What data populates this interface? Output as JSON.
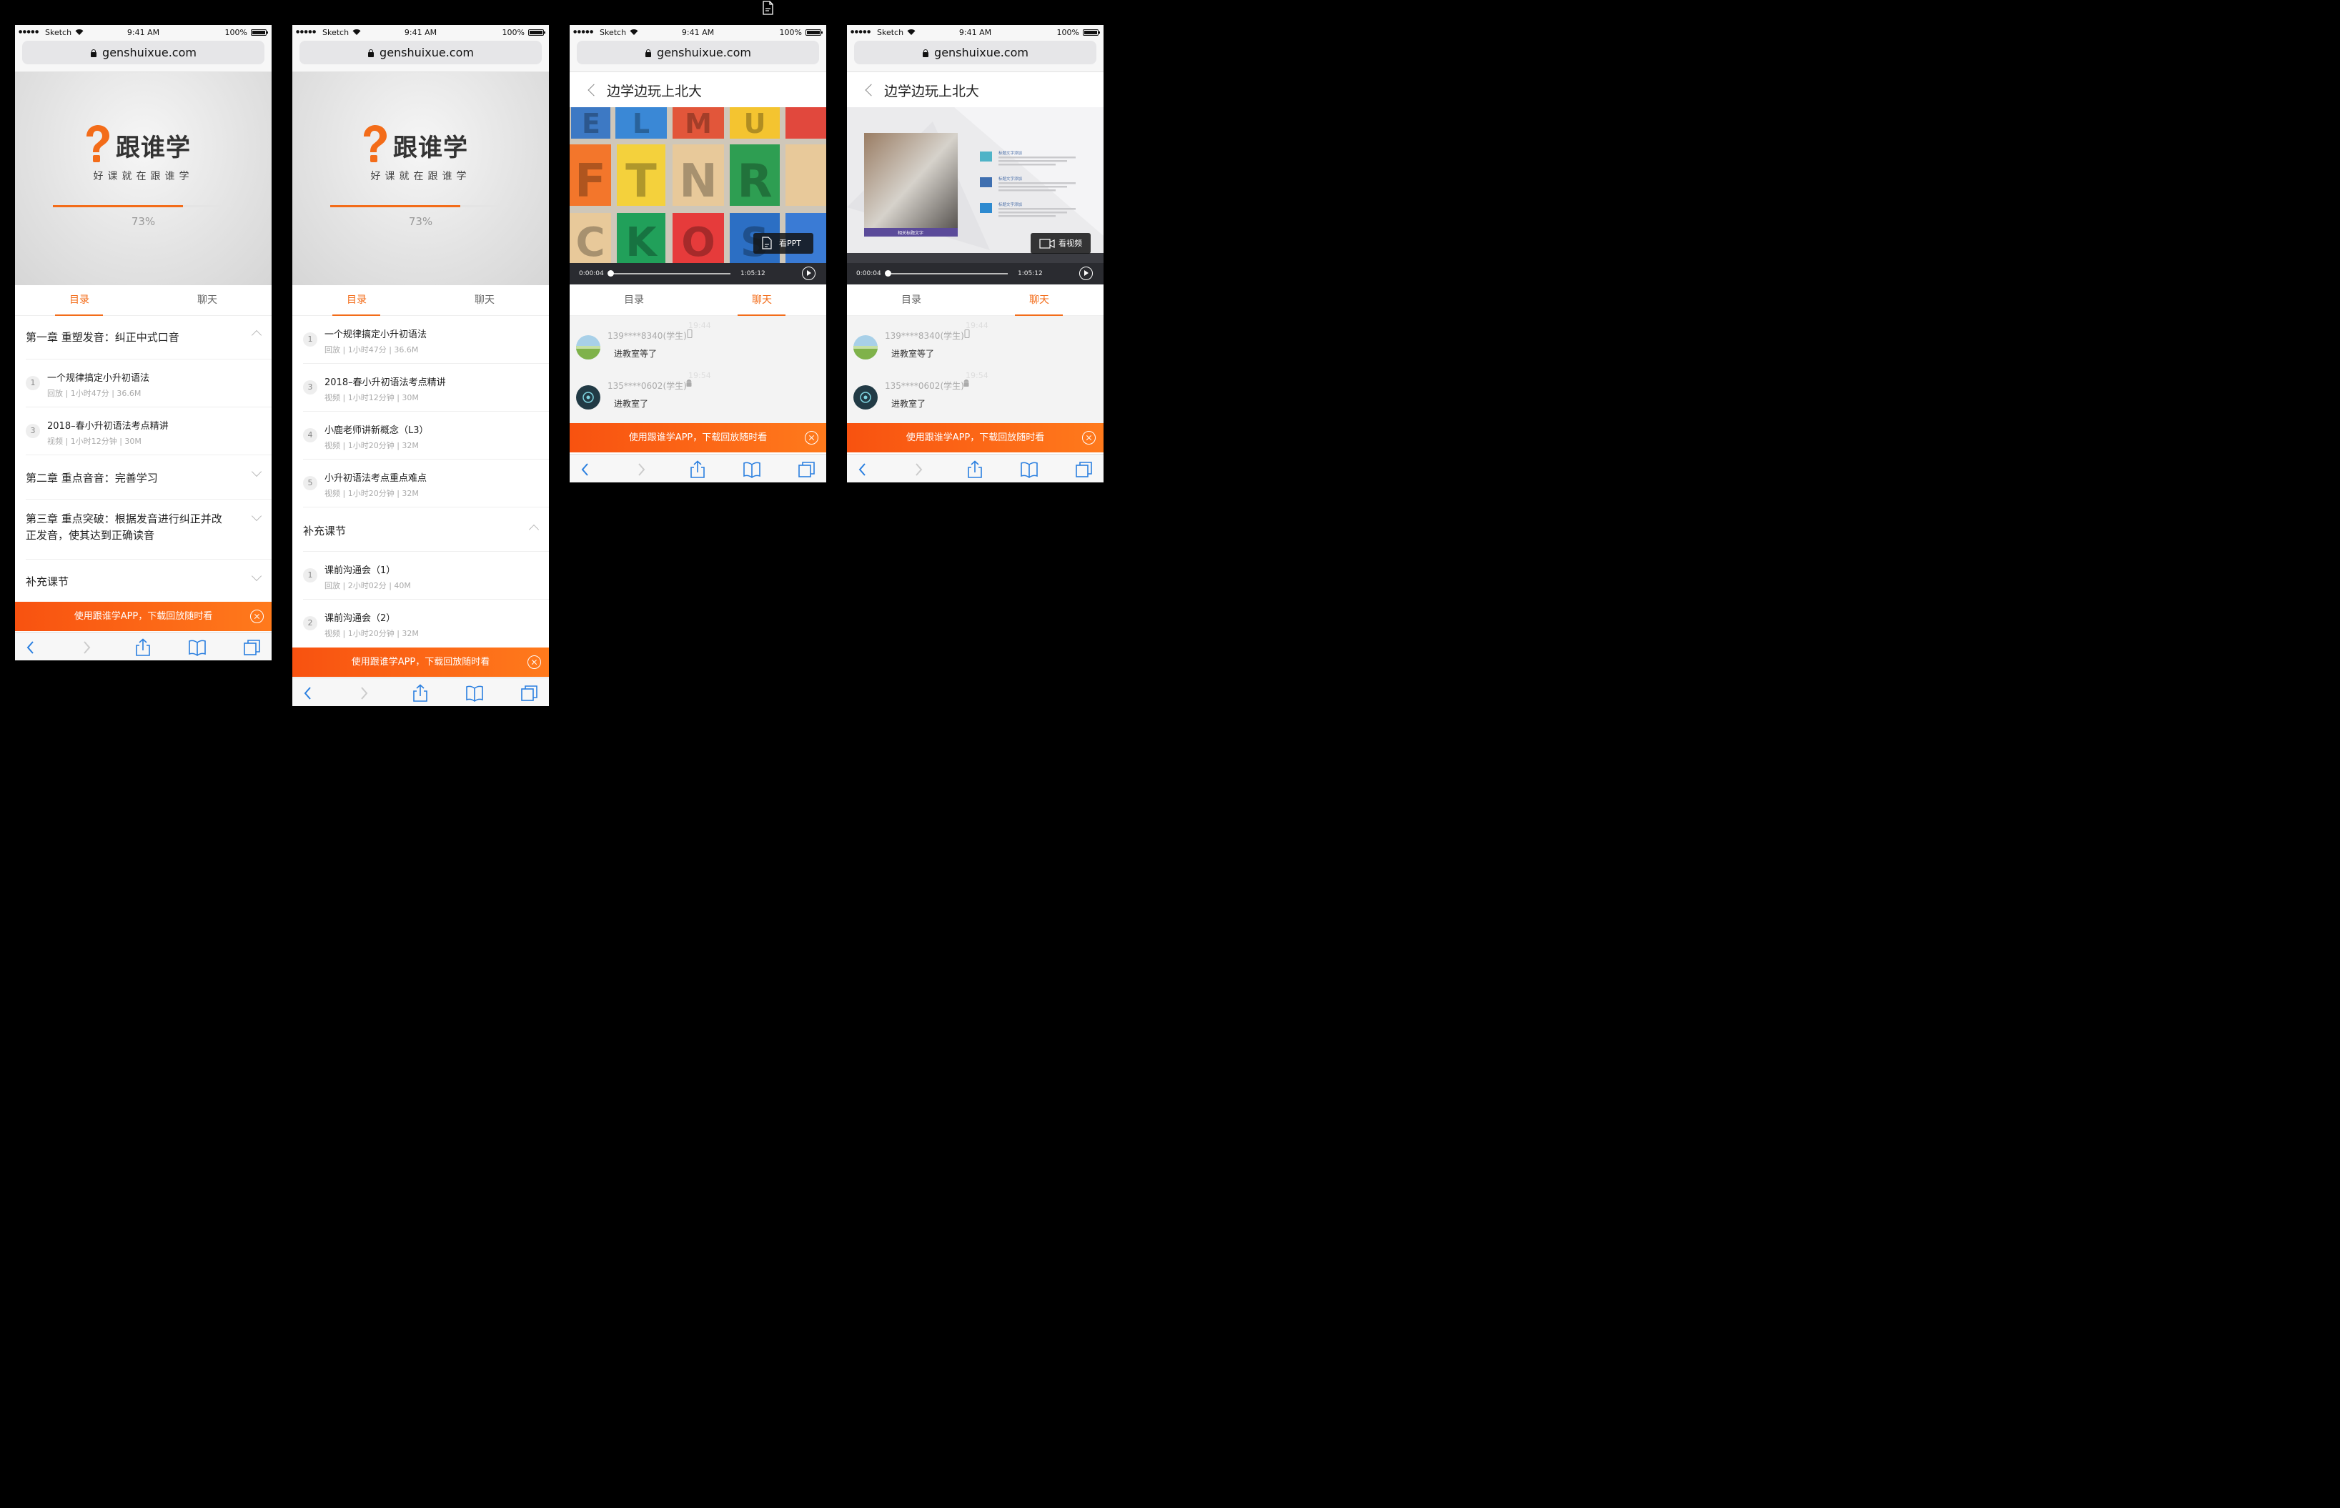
{
  "status_bar": {
    "carrier": "Sketch",
    "time": "9:41 AM",
    "battery": "100%"
  },
  "browser": {
    "url": "genshuixue.com"
  },
  "splash": {
    "brand": "跟谁学",
    "slogan": "好课就在跟谁学",
    "progress_fraction": 0.73,
    "progress_label": "73%"
  },
  "tabs": {
    "catalog": "目录",
    "chat": "聊天"
  },
  "screen1": {
    "chapter1": "第一章 重塑发音：纠正中式口音",
    "lessons": [
      {
        "num": "1",
        "title": "一个规律搞定小升初语法",
        "meta": "回放 | 1小时47分 | 36.6M"
      },
      {
        "num": "3",
        "title": "2018–春小升初语法考点精讲",
        "meta": "视频 | 1小时12分钟 | 30M"
      }
    ],
    "chapter2": "第二章 重点音音：完善学习",
    "chapter3": "第三章 重点突破：根据发音进行纠正并改正发音，使其达到正确读音",
    "supplement": "补充课节"
  },
  "screen2": {
    "lessons": [
      {
        "num": "1",
        "title": "一个规律搞定小升初语法",
        "meta": "回放 | 1小时47分 | 36.6M"
      },
      {
        "num": "3",
        "title": "2018–春小升初语法考点精讲",
        "meta": "视频 | 1小时12分钟 | 30M"
      },
      {
        "num": "4",
        "title": "小鹿老师讲新概念（L3）",
        "meta": "视频 | 1小时20分钟 | 32M"
      },
      {
        "num": "5",
        "title": "小升初语法考点重点难点",
        "meta": "视频 | 1小时20分钟 | 32M"
      }
    ],
    "supplement": "补充课节",
    "extra_lessons": [
      {
        "num": "1",
        "title": "课前沟通会（1）",
        "meta": "回放 | 2小时02分 | 40M"
      },
      {
        "num": "2",
        "title": "课前沟通会（2）",
        "meta": "视频 | 1小时20分钟 | 32M"
      }
    ]
  },
  "player": {
    "title": "边学边玩上北大",
    "current_time": "0:00:04",
    "duration": "1:05:12",
    "view_ppt": "看PPT",
    "view_video": "看视频",
    "letters": [
      "E",
      "L",
      "M",
      "U",
      "F",
      "T",
      "N",
      "R",
      "C",
      "K",
      "O",
      "S"
    ],
    "slide_caption": "相关标题文字",
    "slide_items": [
      "标题文字添加",
      "标题文字添加",
      "标题文字添加"
    ]
  },
  "chat": {
    "messages": [
      {
        "time": "19:44",
        "user": "139****8340(学生)",
        "text": "进教室等了",
        "device": "phone-icon"
      },
      {
        "time": "19:54",
        "user": "135****0602(学生)",
        "text": "进教室了",
        "device": "android-icon"
      }
    ]
  },
  "banner": {
    "text": "使用跟谁学APP，下载回放随时看"
  },
  "colors": {
    "accent": "#f36c19",
    "banner": "#f85210",
    "player_bar": "#2a2b30"
  }
}
